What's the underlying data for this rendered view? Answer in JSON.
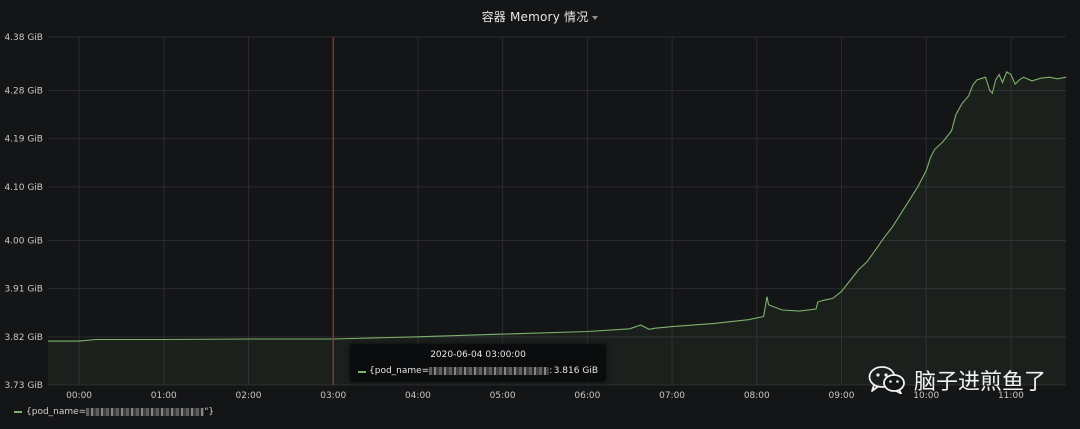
{
  "panel": {
    "title": "容器 Memory 情况"
  },
  "tooltip": {
    "time": "2020-06-04 03:00:00",
    "series_prefix": "{pod_name=",
    "series_suffix": ":",
    "value": "3.816 GiB"
  },
  "legend": {
    "prefix": "{pod_name=",
    "suffix": "\"}"
  },
  "watermark": {
    "text": "脑子进煎鱼了",
    "icon": "wechat-icon"
  },
  "colors": {
    "series": "#7eb26d",
    "cursor": "#c4342f",
    "grid": "#2a2b2e",
    "background": "#141517"
  },
  "chart_data": {
    "type": "area",
    "ylim": [
      3.73,
      4.38
    ],
    "yticks": [
      "3.73 GiB",
      "3.82 GiB",
      "3.91 GiB",
      "4.00 GiB",
      "4.10 GiB",
      "4.19 GiB",
      "4.28 GiB",
      "4.38 GiB"
    ],
    "ytick_values": [
      3.73,
      3.82,
      3.91,
      4.0,
      4.1,
      4.19,
      4.28,
      4.38
    ],
    "xlim": [
      -0.3667,
      11.65
    ],
    "xticks": [
      "00:00",
      "01:00",
      "02:00",
      "03:00",
      "04:00",
      "05:00",
      "06:00",
      "07:00",
      "08:00",
      "09:00",
      "10:00",
      "11:00"
    ],
    "xtick_values": [
      0,
      1,
      2,
      3,
      4,
      5,
      6,
      7,
      8,
      9,
      10,
      11
    ],
    "cursor_x": 3.0,
    "grid": true,
    "legend_position": "bottom-left",
    "series": [
      {
        "x": [
          -0.3667,
          0.0,
          0.2,
          0.6,
          1.0,
          2.0,
          3.0,
          4.0,
          5.0,
          6.0,
          6.5,
          6.63,
          6.68,
          6.73,
          6.8,
          7.0,
          7.5,
          7.9,
          8.08,
          8.12,
          8.14,
          8.2,
          8.3,
          8.5,
          8.7,
          8.72,
          8.78,
          8.9,
          9.0,
          9.1,
          9.2,
          9.3,
          9.4,
          9.5,
          9.6,
          9.7,
          9.8,
          9.9,
          10.0,
          10.05,
          10.1,
          10.2,
          10.3,
          10.35,
          10.42,
          10.5,
          10.55,
          10.6,
          10.7,
          10.75,
          10.78,
          10.82,
          10.86,
          10.9,
          10.95,
          11.0,
          11.05,
          11.1,
          11.15,
          11.25,
          11.35,
          11.45,
          11.55,
          11.65
        ],
        "values": [
          3.812,
          3.812,
          3.815,
          3.815,
          3.815,
          3.816,
          3.816,
          3.82,
          3.825,
          3.83,
          3.835,
          3.842,
          3.838,
          3.834,
          3.836,
          3.839,
          3.845,
          3.852,
          3.858,
          3.895,
          3.88,
          3.876,
          3.87,
          3.868,
          3.872,
          3.885,
          3.888,
          3.892,
          3.905,
          3.925,
          3.945,
          3.96,
          3.982,
          4.005,
          4.025,
          4.05,
          4.075,
          4.1,
          4.13,
          4.155,
          4.17,
          4.185,
          4.205,
          4.235,
          4.255,
          4.27,
          4.29,
          4.3,
          4.305,
          4.28,
          4.275,
          4.3,
          4.31,
          4.295,
          4.315,
          4.31,
          4.292,
          4.3,
          4.305,
          4.298,
          4.303,
          4.305,
          4.302,
          4.305
        ]
      }
    ]
  }
}
